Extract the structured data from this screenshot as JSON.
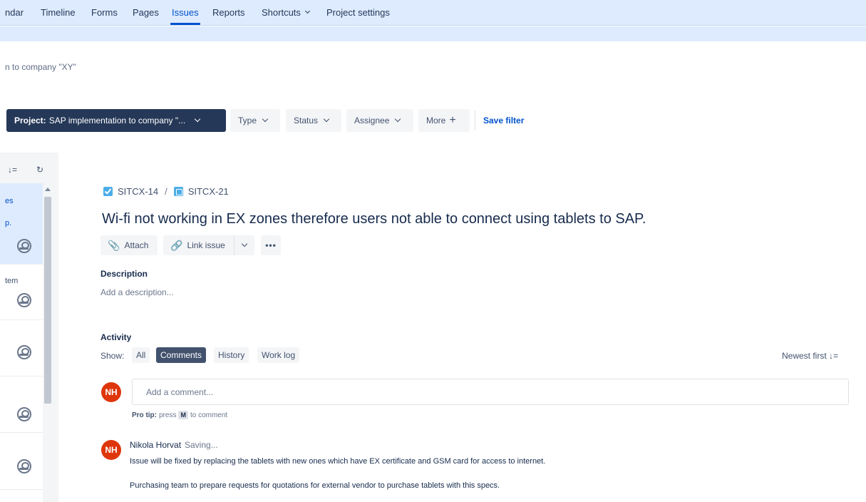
{
  "nav": {
    "items": [
      "ndar",
      "Timeline",
      "Forms",
      "Pages",
      "Issues",
      "Reports",
      "Shortcuts",
      "Project settings"
    ],
    "active": "Issues"
  },
  "breadcrumb_project": "n to company \"XY\"",
  "filters": {
    "project_label": "Project:",
    "project_value": "SAP implementation to company \"...",
    "type": "Type",
    "status": "Status",
    "assignee": "Assignee",
    "more": "More",
    "more_icon": "+",
    "save_filter": "Save filter"
  },
  "list": {
    "tool_sort_icon": "↓=",
    "tool_refresh_icon": "↻",
    "rows": [
      {
        "text": "es",
        "text2": "p."
      },
      {
        "text": "tem"
      },
      {
        "text": ""
      },
      {
        "text": ""
      },
      {
        "text": ""
      }
    ]
  },
  "issue": {
    "parent_key": "SITCX-14",
    "key": "SITCX-21",
    "title": "Wi-fi not working in EX zones therefore users not able to connect using tablets to SAP.",
    "attach": "Attach",
    "link_issue": "Link issue",
    "more_actions": "•••",
    "description_label": "Description",
    "description_placeholder": "Add a description..."
  },
  "activity": {
    "label": "Activity",
    "show": "Show:",
    "filters": [
      "All",
      "Comments",
      "History",
      "Work log"
    ],
    "active_filter": "Comments",
    "sort": "Newest first",
    "sort_icon": "↓="
  },
  "comment_box": {
    "avatar": "NH",
    "placeholder": "Add a comment...",
    "protip_bold": "Pro tip:",
    "protip_pre": "press",
    "protip_key": "M",
    "protip_post": "to comment"
  },
  "comments": [
    {
      "avatar": "NH",
      "author": "Nikola Horvat",
      "status": "Saving...",
      "lines": [
        "Issue will be fixed by replacing the tablets with new ones which have EX certificate and GSM card for access to internet.",
        "Purchasing team to prepare requests for quotations for external vendor to purchase tablets with this specs."
      ]
    }
  ],
  "colors": {
    "nav_bg": "#deebff",
    "primary_filter_bg": "#253858",
    "link": "#0052cc",
    "avatar_nh": "#de350b",
    "active_pill": "#42526e"
  }
}
